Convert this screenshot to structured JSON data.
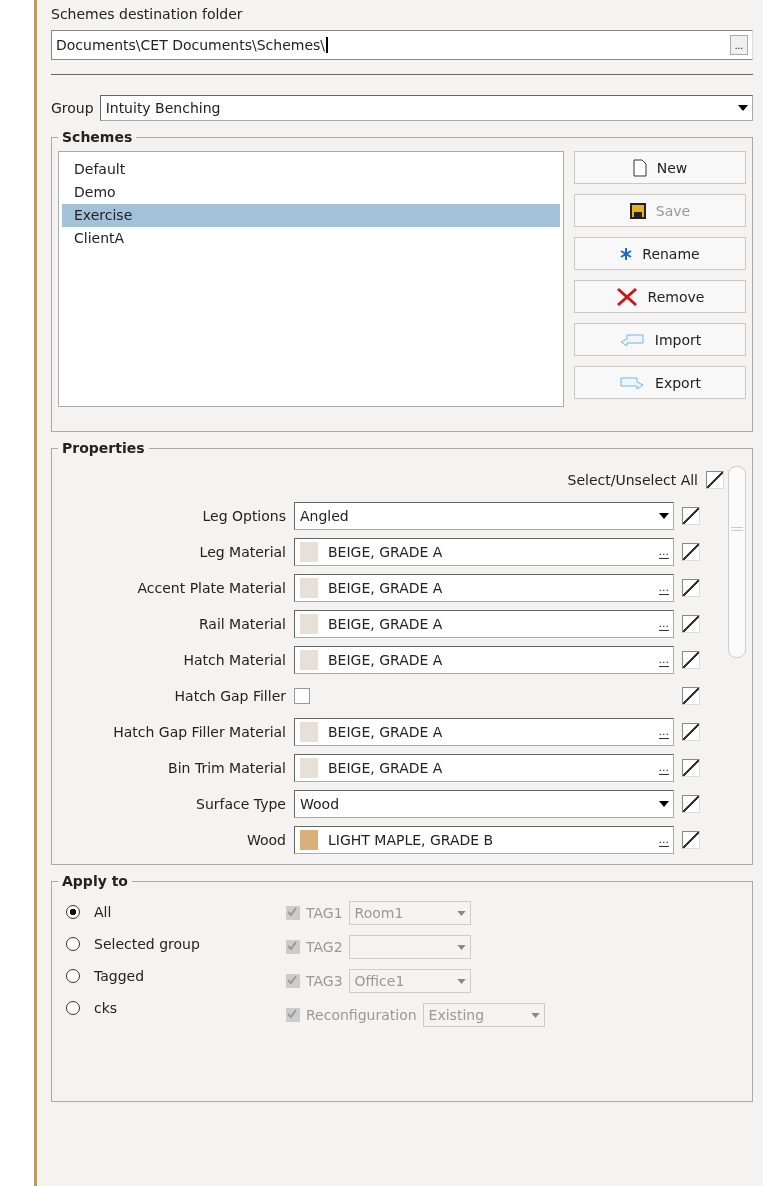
{
  "destination": {
    "label": "Schemes destination folder",
    "value": "Documents\\CET Documents\\Schemes\\",
    "browse": "..."
  },
  "group": {
    "label": "Group",
    "value": "Intuity Benching"
  },
  "schemes": {
    "title": "Schemes",
    "items": [
      {
        "label": "Default",
        "selected": false
      },
      {
        "label": "Demo",
        "selected": false
      },
      {
        "label": "Exercise",
        "selected": true
      },
      {
        "label": "ClientA",
        "selected": false
      }
    ],
    "buttons": [
      {
        "label": "New",
        "disabled": false
      },
      {
        "label": "Save",
        "disabled": true
      },
      {
        "label": "Rename",
        "disabled": false
      },
      {
        "label": "Remove",
        "disabled": false
      },
      {
        "label": "Import",
        "disabled": false
      },
      {
        "label": "Export",
        "disabled": false
      }
    ]
  },
  "properties": {
    "title": "Properties",
    "select_all": {
      "label": "Select/Unselect All",
      "checked": true
    },
    "rows": [
      {
        "kind": "select",
        "label": "Leg Options",
        "value": "Angled",
        "checked": true
      },
      {
        "kind": "material",
        "label": "Leg Material",
        "value": "BEIGE, GRADE A",
        "color": "#e8e0d8",
        "browse": "...",
        "checked": true
      },
      {
        "kind": "material",
        "label": "Accent Plate Material",
        "value": "BEIGE, GRADE A",
        "color": "#e8e0d8",
        "browse": "...",
        "checked": true
      },
      {
        "kind": "material",
        "label": "Rail Material",
        "value": "BEIGE, GRADE A",
        "color": "#e8e0d8",
        "browse": "...",
        "checked": true
      },
      {
        "kind": "material",
        "label": "Hatch Material",
        "value": "BEIGE, GRADE A",
        "color": "#e8e0d8",
        "browse": "...",
        "checked": true
      },
      {
        "kind": "checkbox",
        "label": "Hatch Gap Filler",
        "on": false,
        "checked": true
      },
      {
        "kind": "material",
        "label": "Hatch Gap Filler Material",
        "value": "BEIGE, GRADE A",
        "color": "#e8e0d8",
        "browse": "...",
        "checked": true
      },
      {
        "kind": "material",
        "label": "Bin Trim Material",
        "value": "BEIGE, GRADE A",
        "color": "#e8e0d8",
        "browse": "...",
        "checked": true
      },
      {
        "kind": "select",
        "label": "Surface Type",
        "value": "Wood",
        "checked": true
      },
      {
        "kind": "material",
        "label": "Wood",
        "value": "LIGHT MAPLE, GRADE B",
        "color": "#d9b07a",
        "browse": "...",
        "checked": true
      }
    ]
  },
  "apply_to": {
    "title": "Apply to",
    "options": [
      {
        "label": "All",
        "selected": true
      },
      {
        "label": "Selected group",
        "selected": false
      },
      {
        "label": "Tagged",
        "selected": false
      },
      {
        "label": "cks",
        "selected": false
      }
    ],
    "tags": [
      {
        "label": "TAG1",
        "value": "Room1",
        "checked": true,
        "disabled": true
      },
      {
        "label": "TAG2",
        "checked": true,
        "disabled": true
      },
      {
        "label": "TAG3",
        "value": "Office1",
        "checked": true,
        "disabled": true
      },
      {
        "label": "Reconfiguration",
        "value": "Existing",
        "checked": true,
        "disabled": true
      }
    ]
  }
}
